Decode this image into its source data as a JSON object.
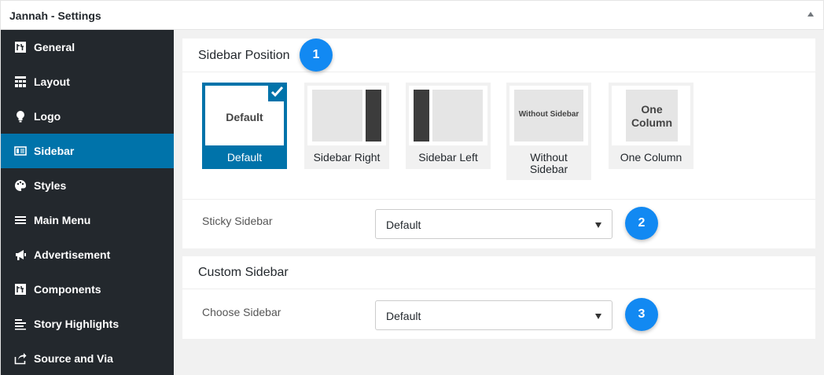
{
  "window": {
    "title": "Jannah - Settings"
  },
  "sidebar": {
    "items": [
      {
        "label": "General",
        "icon": "general-icon"
      },
      {
        "label": "Layout",
        "icon": "layout-icon"
      },
      {
        "label": "Logo",
        "icon": "lightbulb-icon"
      },
      {
        "label": "Sidebar",
        "icon": "sidebar-icon",
        "active": true
      },
      {
        "label": "Styles",
        "icon": "palette-icon"
      },
      {
        "label": "Main Menu",
        "icon": "menu-icon"
      },
      {
        "label": "Advertisement",
        "icon": "megaphone-icon"
      },
      {
        "label": "Components",
        "icon": "components-icon"
      },
      {
        "label": "Story Highlights",
        "icon": "list-icon"
      },
      {
        "label": "Source and Via",
        "icon": "share-icon"
      }
    ]
  },
  "sidebar_position": {
    "title": "Sidebar Position",
    "badge": "1",
    "options": [
      {
        "caption": "Default",
        "thumb_text": "Default",
        "selected": true
      },
      {
        "caption": "Sidebar Right"
      },
      {
        "caption": "Sidebar Left"
      },
      {
        "caption_line1": "Without",
        "caption_line2": "Sidebar",
        "thumb_text": "Without Sidebar"
      },
      {
        "caption": "One Column",
        "thumb_line1": "One",
        "thumb_line2": "Column"
      }
    ],
    "sticky": {
      "label": "Sticky Sidebar",
      "value": "Default",
      "badge": "2"
    }
  },
  "custom_sidebar": {
    "title": "Custom Sidebar",
    "choose": {
      "label": "Choose Sidebar",
      "value": "Default",
      "badge": "3"
    }
  },
  "colors": {
    "sidebar_bg": "#23282d",
    "active_bg": "#0073aa",
    "badge_bg": "#1289f2",
    "main_bg": "#f1f1f1",
    "thumb_dark": "#3c3c3c",
    "thumb_light": "#e5e5e5"
  }
}
